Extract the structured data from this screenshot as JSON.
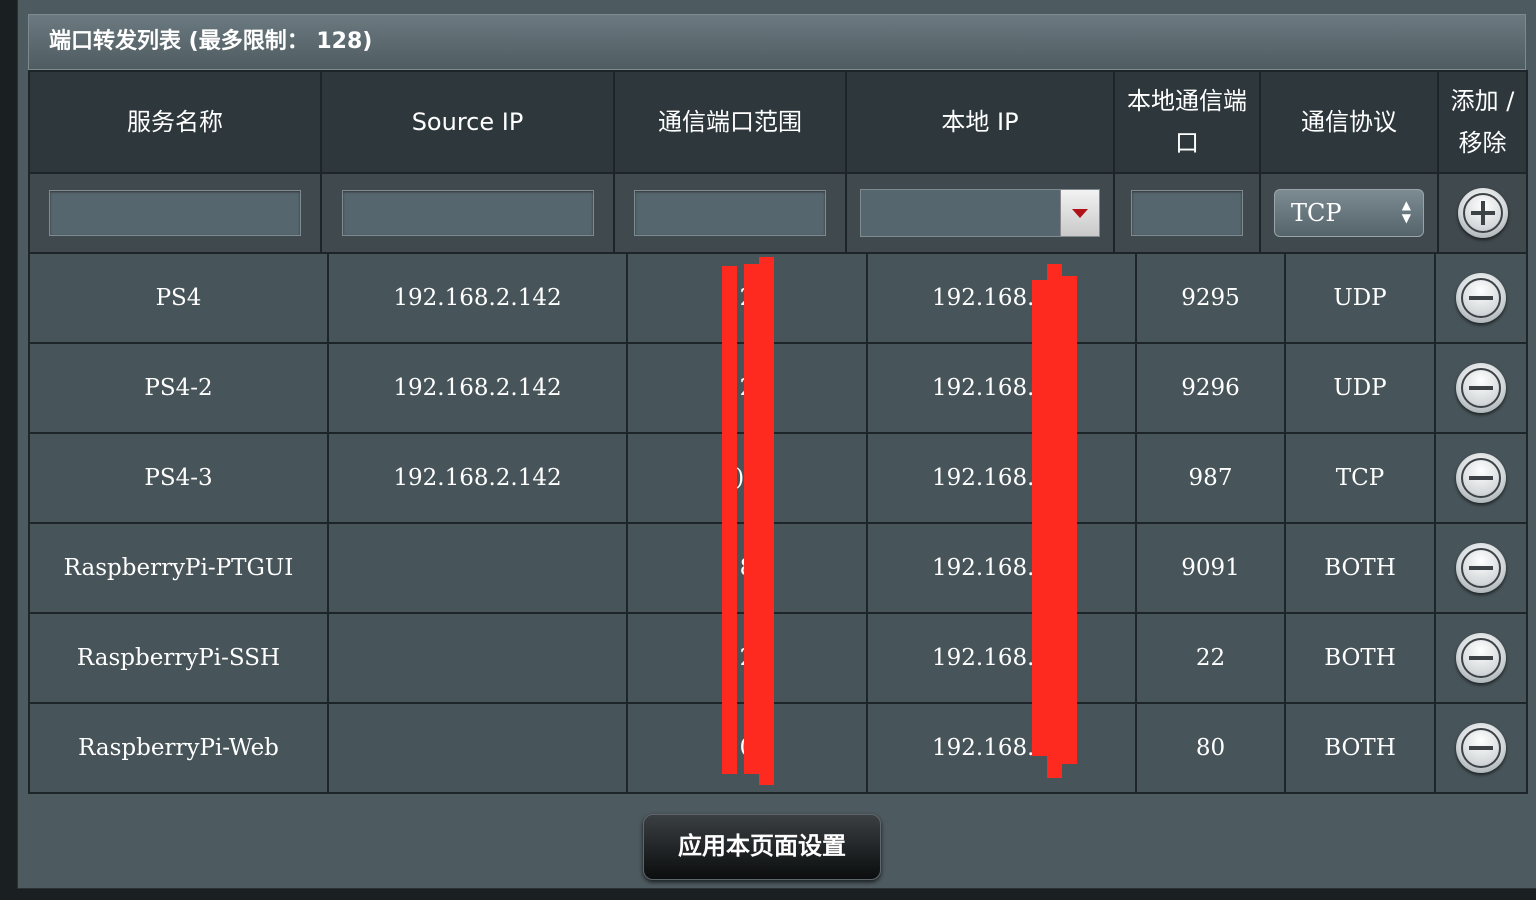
{
  "panel": {
    "title": "端口转发列表 (最多限制： 128)"
  },
  "columns": [
    "服务名称",
    "Source IP",
    "通信端口范围",
    "本地 IP",
    "本地通信端口",
    "通信协议",
    "添加 / 移除"
  ],
  "input_row": {
    "service_name_value": "",
    "source_ip_value": "",
    "port_range_value": "",
    "local_ip_value": "",
    "local_port_value": "",
    "protocol_selected": "TCP",
    "add_icon": "plus-circle-icon"
  },
  "rows": [
    {
      "name": "PS4",
      "source_ip": "192.168.2.142",
      "port_range": "2",
      "local_ip": "192.168.2.",
      "local_port": "9295",
      "protocol": "UDP"
    },
    {
      "name": "PS4-2",
      "source_ip": "192.168.2.142",
      "port_range": "2",
      "local_ip": "192.168.2.",
      "local_port": "9296",
      "protocol": "UDP"
    },
    {
      "name": "PS4-3",
      "source_ip": "192.168.2.142",
      "port_range": ")8",
      "local_ip": "192.168.2.",
      "local_port": "987",
      "protocol": "TCP"
    },
    {
      "name": "RaspberryPi-PTGUI",
      "source_ip": "",
      "port_range": "8",
      "local_ip": "192.168.2.",
      "local_port": "9091",
      "protocol": "BOTH"
    },
    {
      "name": "RaspberryPi-SSH",
      "source_ip": "",
      "port_range": "2",
      "local_ip": "192.168.2.",
      "local_port": "22",
      "protocol": "BOTH"
    },
    {
      "name": "RaspberryPi-Web",
      "source_ip": "",
      "port_range": "0",
      "local_ip": "192.168.2.",
      "local_port": "80",
      "protocol": "BOTH"
    }
  ],
  "remove_icon": "minus-circle-icon",
  "apply_button": "应用本页面设置",
  "colors": {
    "panel_bg": "#4d5a60",
    "header_bg": "#2e373b",
    "row_bg": "#475459",
    "redaction": "#ff2a1f"
  }
}
